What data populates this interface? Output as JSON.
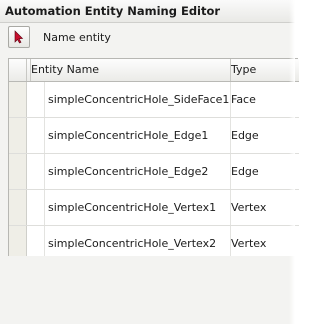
{
  "window": {
    "title": "Automation Entity Naming Editor"
  },
  "toolbar": {
    "name_entity_label": "Name entity",
    "select_icon": "cursor-arrow-icon"
  },
  "grid": {
    "columns": [
      "Entity Name",
      "Type"
    ],
    "rows": [
      {
        "name": "simpleConcentricHole_SideFace1",
        "type": "Face"
      },
      {
        "name": "simpleConcentricHole_Edge1",
        "type": "Edge"
      },
      {
        "name": "simpleConcentricHole_Edge2",
        "type": "Edge"
      },
      {
        "name": "simpleConcentricHole_Vertex1",
        "type": "Vertex"
      },
      {
        "name": "simpleConcentricHole_Vertex2",
        "type": "Vertex"
      }
    ]
  },
  "colors": {
    "accent_icon": "#c8102e",
    "window_bg": "#f3f3f1"
  }
}
